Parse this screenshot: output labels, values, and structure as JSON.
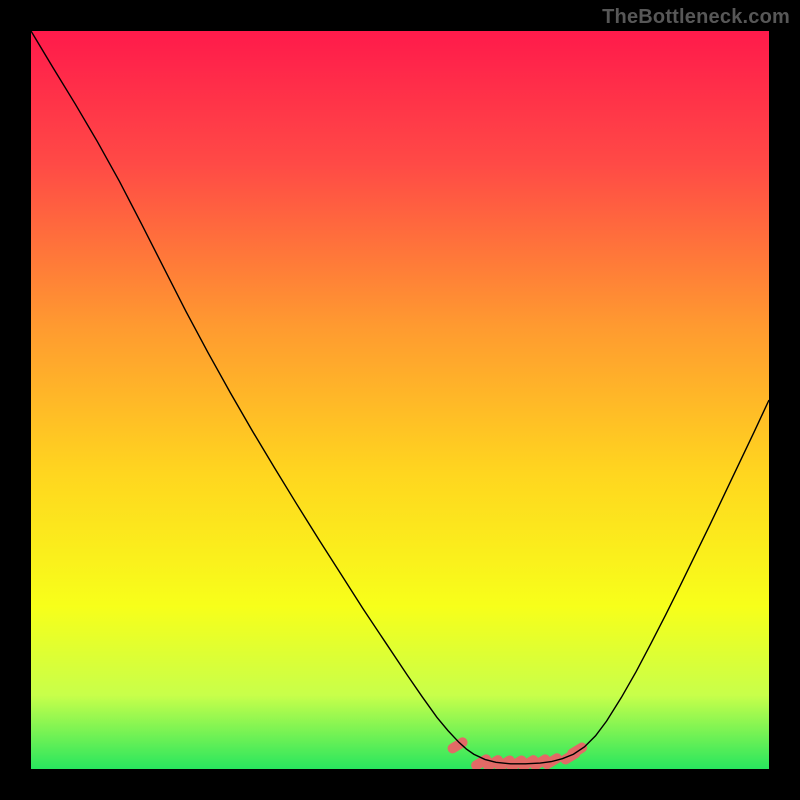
{
  "watermark": "TheBottleneck.com",
  "chart_data": {
    "type": "line",
    "title": "",
    "xlabel": "",
    "ylabel": "",
    "xlim": [
      0,
      100
    ],
    "ylim": [
      0,
      100
    ],
    "gradient_stops": [
      {
        "offset": 0,
        "color": "#ff1a4b"
      },
      {
        "offset": 18,
        "color": "#ff4a46"
      },
      {
        "offset": 40,
        "color": "#ff9a30"
      },
      {
        "offset": 60,
        "color": "#ffd61f"
      },
      {
        "offset": 78,
        "color": "#f7ff1a"
      },
      {
        "offset": 90,
        "color": "#c8ff4a"
      },
      {
        "offset": 100,
        "color": "#28e65e"
      }
    ],
    "series": [
      {
        "name": "curve",
        "stroke": "#000000",
        "width": 1.4,
        "points": [
          [
            0.0,
            100.0
          ],
          [
            3.0,
            95.0
          ],
          [
            6.0,
            90.1
          ],
          [
            9.0,
            85.0
          ],
          [
            12.0,
            79.6
          ],
          [
            15.0,
            73.8
          ],
          [
            18.0,
            67.9
          ],
          [
            21.0,
            62.0
          ],
          [
            24.0,
            56.4
          ],
          [
            27.0,
            51.0
          ],
          [
            30.0,
            45.8
          ],
          [
            33.0,
            40.8
          ],
          [
            36.0,
            35.9
          ],
          [
            39.0,
            31.1
          ],
          [
            42.0,
            26.4
          ],
          [
            45.0,
            21.7
          ],
          [
            48.0,
            17.2
          ],
          [
            51.0,
            12.7
          ],
          [
            53.0,
            9.8
          ],
          [
            55.0,
            7.0
          ],
          [
            56.5,
            5.2
          ],
          [
            58.0,
            3.6
          ],
          [
            59.0,
            2.7
          ],
          [
            60.0,
            2.0
          ],
          [
            61.5,
            1.3
          ],
          [
            63.0,
            0.9
          ],
          [
            65.0,
            0.7
          ],
          [
            67.0,
            0.7
          ],
          [
            69.0,
            0.8
          ],
          [
            70.5,
            1.0
          ],
          [
            72.0,
            1.4
          ],
          [
            73.5,
            2.0
          ],
          [
            75.0,
            3.0
          ],
          [
            76.5,
            4.5
          ],
          [
            78.0,
            6.5
          ],
          [
            80.0,
            9.7
          ],
          [
            82.0,
            13.2
          ],
          [
            84.0,
            17.0
          ],
          [
            86.0,
            20.9
          ],
          [
            88.0,
            24.9
          ],
          [
            90.0,
            29.0
          ],
          [
            92.0,
            33.1
          ],
          [
            94.0,
            37.3
          ],
          [
            96.0,
            41.5
          ],
          [
            98.0,
            45.7
          ],
          [
            100.0,
            50.0
          ]
        ]
      },
      {
        "name": "highlight-dots",
        "stroke": "#e26a66",
        "type_hint": "scatter-bar",
        "points": [
          [
            57.8,
            3.2
          ],
          [
            61.0,
            0.9
          ],
          [
            62.6,
            0.8
          ],
          [
            64.2,
            0.75
          ],
          [
            65.8,
            0.75
          ],
          [
            67.4,
            0.8
          ],
          [
            69.0,
            0.9
          ],
          [
            70.6,
            1.05
          ],
          [
            73.1,
            1.7
          ],
          [
            74.0,
            2.5
          ]
        ]
      }
    ]
  }
}
